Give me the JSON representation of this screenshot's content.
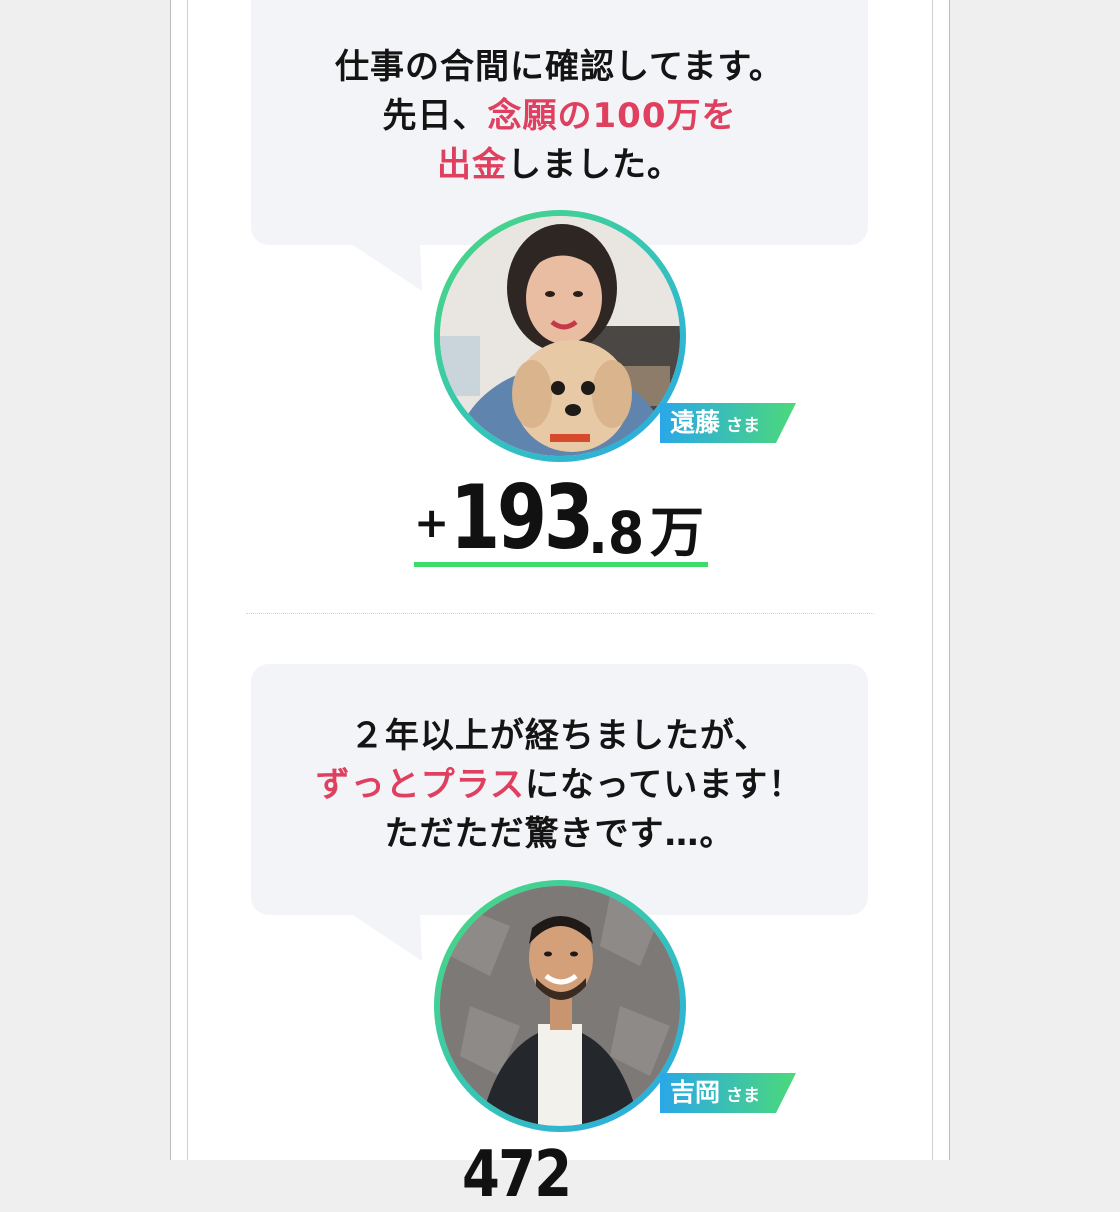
{
  "testimonials": [
    {
      "quote_line1": "仕事の合間に確認してます。",
      "quote_line2_pre": "先日、",
      "quote_line2_hl": "念願の100万を",
      "quote_line3_hl": "出金",
      "quote_line3_post": "しました。",
      "name": "遠藤",
      "honorific": "さま",
      "amount_sign": "+",
      "amount_int": "193",
      "amount_dec": ".8",
      "amount_unit": "万"
    },
    {
      "quote_line1": "２年以上が経ちましたが、",
      "quote_line2_hl": "ずっとプラス",
      "quote_line2_post": "になっています！",
      "quote_line3": "ただただ驚きです…。",
      "name": "吉岡",
      "honorific": "さま",
      "amount_partial": "472"
    }
  ],
  "colors": {
    "highlight": "#e0405f",
    "underline": "#3ddc6a",
    "bubble": "#f3f4f7",
    "ring_start": "#4cd97a",
    "ring_end": "#2aa7e8"
  },
  "icons": {
    "avatar1": "woman-with-dog-photo",
    "avatar2": "man-in-coat-photo"
  }
}
